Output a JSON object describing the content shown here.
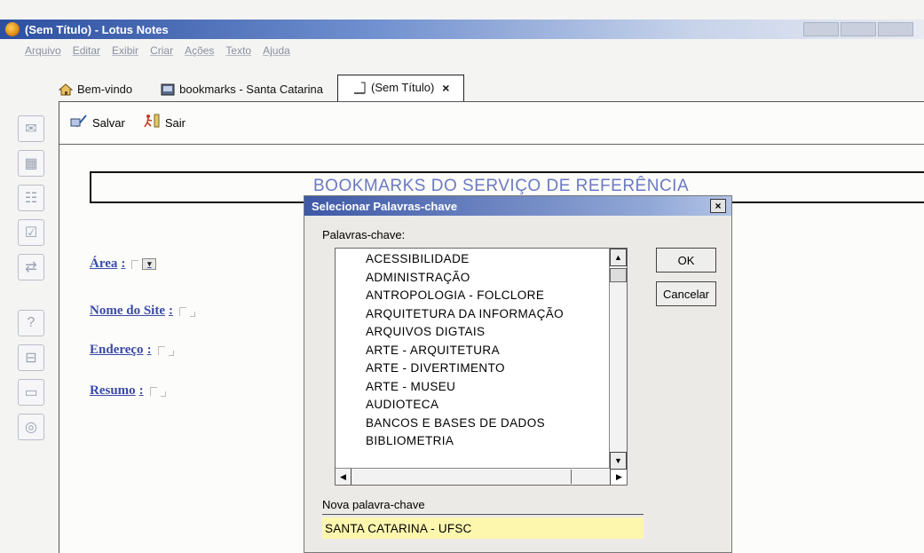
{
  "window": {
    "title": "(Sem Título) - Lotus Notes"
  },
  "menu": [
    "Arquivo",
    "Editar",
    "Exibir",
    "Criar",
    "Ações",
    "Texto",
    "Ajuda"
  ],
  "tabs": [
    {
      "label": "Bem-vindo",
      "icon": "home-icon"
    },
    {
      "label": "bookmarks - Santa Catarina",
      "icon": "database-icon"
    },
    {
      "label": "(Sem Título)",
      "icon": "document-icon",
      "active": true
    }
  ],
  "tab_close": "×",
  "actions": {
    "save_label": "Salvar",
    "exit_label": "Sair"
  },
  "form": {
    "banner_title": "BOOKMARKS DO SERVIÇO DE REFERÊNCIA",
    "fields": {
      "area": "Área",
      "site_name": "Nome do Site",
      "address": "Endereço",
      "summary": "Resumo"
    },
    "colon": ":"
  },
  "dialog": {
    "title": "Selecionar Palavras-chave",
    "close": "×",
    "keywords_label": "Palavras-chave:",
    "keywords": [
      "ACESSIBILIDADE",
      "ADMINISTRAÇÃO",
      "ANTROPOLOGIA - FOLCLORE",
      "ARQUITETURA DA INFORMAÇÃO",
      "ARQUIVOS DIGTAIS",
      "ARTE - ARQUITETURA",
      "ARTE - DIVERTIMENTO",
      "ARTE - MUSEU",
      "AUDIOTECA",
      "BANCOS E BASES DE DADOS",
      "BIBLIOMETRIA"
    ],
    "ok_label": "OK",
    "cancel_label": "Cancelar",
    "new_keyword_label": "Nova palavra-chave",
    "new_keyword_value": "SANTA CATARINA - UFSC"
  },
  "colors": {
    "title_bar": "#2c4fa0",
    "field_label": "#3b4aa8",
    "banner_text": "#6b79c2",
    "input_highlight": "#fdf7ae"
  }
}
